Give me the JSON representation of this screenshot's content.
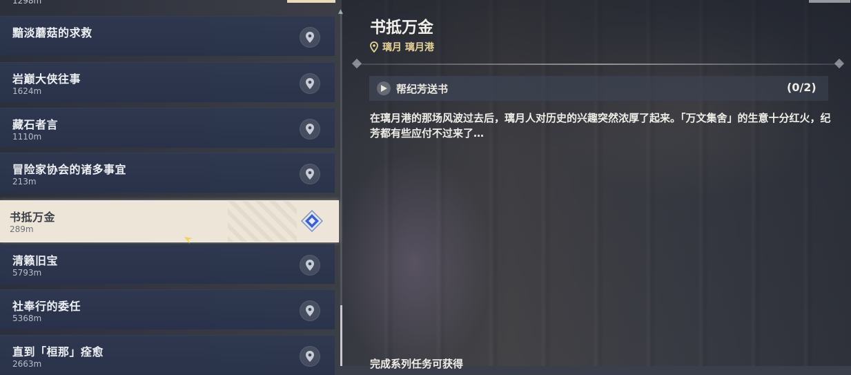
{
  "quest_list": {
    "top_partial_distance": "1298m",
    "items": [
      {
        "name": "黯淡蘑菇的求救",
        "distance": ""
      },
      {
        "name": "岩巅大侠往事",
        "distance": "1624m"
      },
      {
        "name": "藏石者言",
        "distance": "1110m"
      },
      {
        "name": "冒险家协会的诸多事宜",
        "distance": "213m"
      },
      {
        "name": "书抵万金",
        "distance": "289m"
      },
      {
        "name": "清籁旧宝",
        "distance": "5793m"
      },
      {
        "name": "社奉行的委任",
        "distance": "5368m"
      },
      {
        "name": "直到「桓那」痊愈",
        "distance": "2663m"
      }
    ],
    "selected_index": 4
  },
  "detail": {
    "title": "书抵万金",
    "location": "璃月 璃月港",
    "step": {
      "label": "帮纪芳送书",
      "progress": "(0/2)"
    },
    "description": "在璃月港的那场风波过去后，璃月人对历史的兴趣突然浓厚了起来。「万文集舍」的生意十分红火，纪芳都有些应付不过来了…",
    "reward_label": "完成系列任务可获得"
  },
  "colors": {
    "accent_gold": "#e6d39a",
    "selected_bg": "#ece5d8",
    "item_bg": "#2e3850",
    "diamond_blue": "#3a5fd0"
  },
  "icons": [
    "map-pin-icon",
    "quest-diamond-icon",
    "play-icon",
    "location-pin-icon"
  ]
}
